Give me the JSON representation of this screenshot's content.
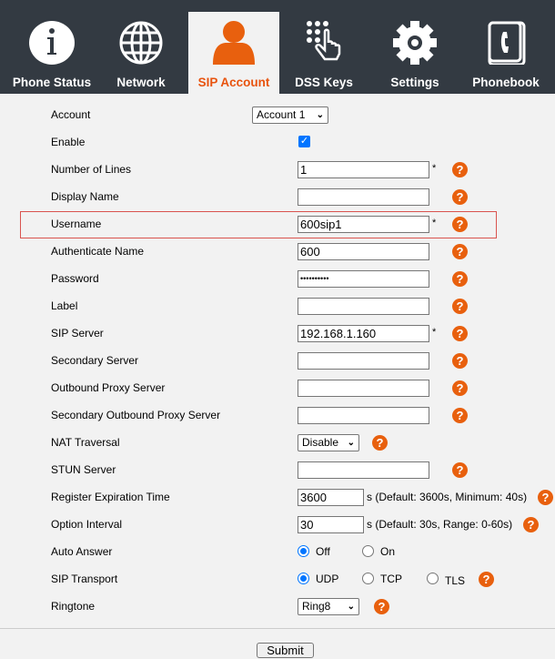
{
  "nav": {
    "tabs": [
      {
        "label": "Phone Status",
        "icon": "info-icon"
      },
      {
        "label": "Network",
        "icon": "globe-icon"
      },
      {
        "label": "SIP Account",
        "icon": "user-icon",
        "active": true
      },
      {
        "label": "DSS Keys",
        "icon": "keypad-icon"
      },
      {
        "label": "Settings",
        "icon": "gear-icon"
      },
      {
        "label": "Phonebook",
        "icon": "phonebook-icon"
      }
    ]
  },
  "accent": "#e8540f",
  "form": {
    "account": {
      "label": "Account",
      "value": "Account 1"
    },
    "enable": {
      "label": "Enable",
      "checked": true
    },
    "lines": {
      "label": "Number of Lines",
      "value": "1",
      "required": "*"
    },
    "display": {
      "label": "Display Name",
      "value": ""
    },
    "username": {
      "label": "Username",
      "value": "600sip1",
      "required": "*"
    },
    "auth": {
      "label": "Authenticate Name",
      "value": "600"
    },
    "password": {
      "label": "Password",
      "value": "••••••••••"
    },
    "label": {
      "label": "Label",
      "value": ""
    },
    "server": {
      "label": "SIP Server",
      "value": "192.168.1.160",
      "required": "*"
    },
    "secondary": {
      "label": "Secondary Server",
      "value": ""
    },
    "outbound": {
      "label": "Outbound Proxy Server",
      "value": ""
    },
    "secoutbound": {
      "label": "Secondary Outbound Proxy Server",
      "value": ""
    },
    "nat": {
      "label": "NAT Traversal",
      "value": "Disable"
    },
    "stun": {
      "label": "STUN Server",
      "value": ""
    },
    "regexp": {
      "label": "Register Expiration Time",
      "value": "3600",
      "note": "s (Default: 3600s, Minimum: 40s)"
    },
    "option": {
      "label": "Option Interval",
      "value": "30",
      "note": "s (Default: 30s, Range: 0-60s)"
    },
    "autoanswer": {
      "label": "Auto Answer",
      "options": [
        "Off",
        "On"
      ],
      "selected": "Off"
    },
    "transport": {
      "label": "SIP Transport",
      "options": [
        "UDP",
        "TCP",
        "TLS"
      ],
      "selected": "UDP"
    },
    "ringtone": {
      "label": "Ringtone",
      "value": "Ring8"
    }
  },
  "help_glyph": "?",
  "submit": "Submit"
}
